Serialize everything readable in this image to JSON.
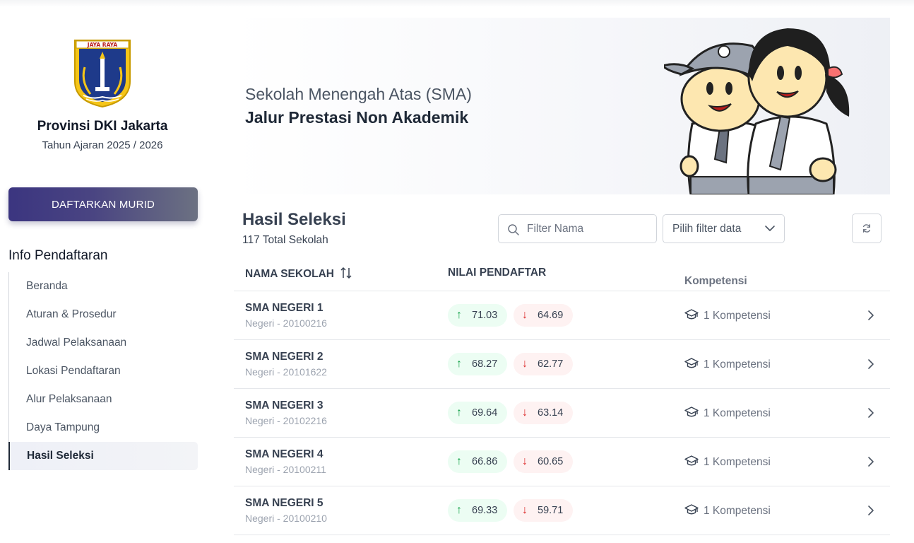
{
  "sidebar": {
    "province": "Provinsi DKI Jakarta",
    "year": "Tahun Ajaran 2025 / 2026",
    "logo_text": "JAYA RAYA",
    "register_label": "DAFTARKAN MURID",
    "info_title": "Info Pendaftaran",
    "nav": [
      {
        "label": "Beranda",
        "active": false
      },
      {
        "label": "Aturan & Prosedur",
        "active": false
      },
      {
        "label": "Jadwal Pelaksanaan",
        "active": false
      },
      {
        "label": "Lokasi Pendaftaran",
        "active": false
      },
      {
        "label": "Alur Pelaksanaan",
        "active": false
      },
      {
        "label": "Daya Tampung",
        "active": false
      },
      {
        "label": "Hasil Seleksi",
        "active": true
      }
    ]
  },
  "banner": {
    "title": "Sekolah Menengah Atas (SMA)",
    "subtitle": "Jalur Prestasi Non Akademik"
  },
  "results": {
    "title": "Hasil Seleksi",
    "count": "117 Total Sekolah",
    "search_placeholder": "Filter Nama",
    "filter_label": "Pilih filter data",
    "columns": {
      "school": "NAMA SEKOLAH",
      "score": "NILAI PENDAFTAR",
      "competence": "Kompetensi"
    },
    "rows": [
      {
        "name": "SMA NEGERI 1",
        "meta": "Negeri - 20100216",
        "high": "71.03",
        "low": "64.69",
        "competence": "1 Kompetensi"
      },
      {
        "name": "SMA NEGERI 2",
        "meta": "Negeri - 20101622",
        "high": "68.27",
        "low": "62.77",
        "competence": "1 Kompetensi"
      },
      {
        "name": "SMA NEGERI 3",
        "meta": "Negeri - 20102216",
        "high": "69.64",
        "low": "63.14",
        "competence": "1 Kompetensi"
      },
      {
        "name": "SMA NEGERI 4",
        "meta": "Negeri - 20100211",
        "high": "66.86",
        "low": "60.65",
        "competence": "1 Kompetensi"
      },
      {
        "name": "SMA NEGERI 5",
        "meta": "Negeri - 20100210",
        "high": "69.33",
        "low": "59.71",
        "competence": "1 Kompetensi"
      }
    ]
  },
  "icons": {
    "search": "search-icon",
    "filter": "chevron-down-icon",
    "refresh": "refresh-icon",
    "sort": "sort-icon",
    "competence": "graduation-cap-icon",
    "row": "chevron-right-icon",
    "up": "↑",
    "down": "↓"
  },
  "colors": {
    "primary_button": "#3b3580",
    "up_pill": "#ecfdf3",
    "down_pill": "#fef2f2",
    "up_arrow": "#16a34a",
    "down_arrow": "#dc2626"
  }
}
